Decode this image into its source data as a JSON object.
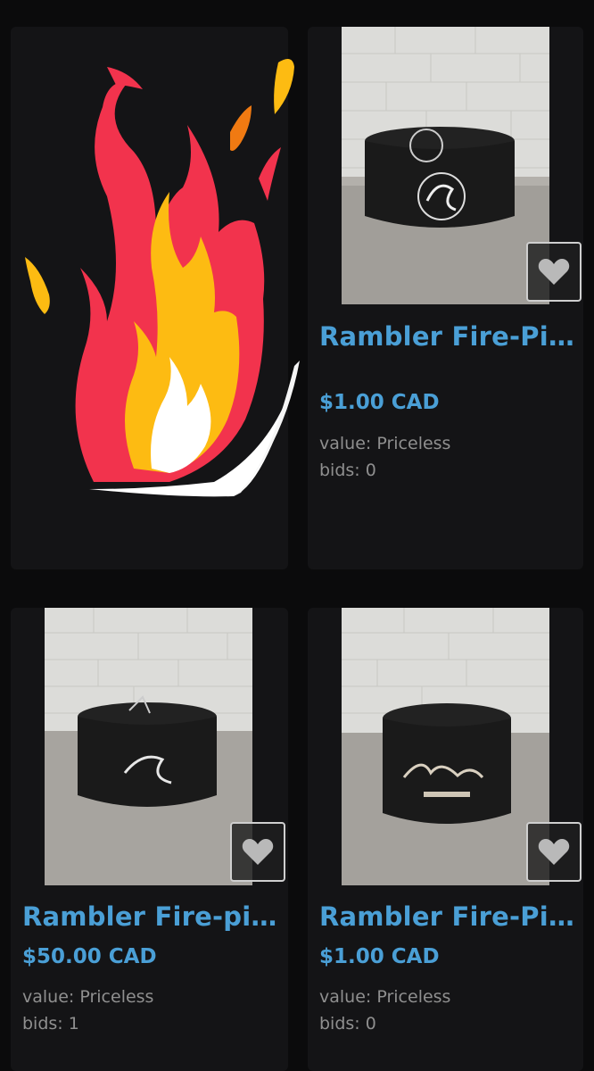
{
  "listings": [
    {
      "title": "Rambler Fire-Pit…",
      "price": "$1.00 CAD",
      "value": "value: Priceless",
      "bids": "bids: 0"
    },
    {
      "title": "Rambler Fire-pit…",
      "price": "$50.00 CAD",
      "value": "value: Priceless",
      "bids": "bids: 1"
    },
    {
      "title": "Rambler Fire-Pit…",
      "price": "$1.00 CAD",
      "value": "value: Priceless",
      "bids": "bids: 0"
    }
  ],
  "icons": {
    "favorite": "heart-icon",
    "promo": "flame-icon"
  },
  "colors": {
    "background": "#0b0b0c",
    "card": "#141416",
    "link": "#4a9fd6",
    "meta": "#8f8f8f",
    "flame_red": "#f2334d",
    "flame_yellow": "#fdbb12",
    "flame_orange": "#f07a12"
  }
}
